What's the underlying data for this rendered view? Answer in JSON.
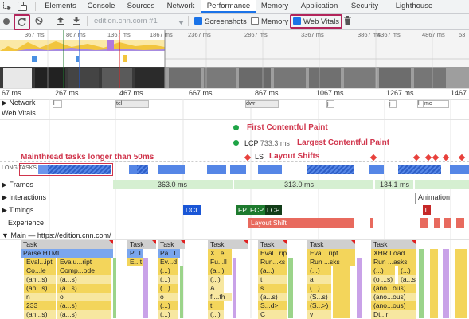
{
  "tabs": {
    "elements": "Elements",
    "console": "Console",
    "sources": "Sources",
    "network": "Network",
    "performance": "Performance",
    "memory": "Memory",
    "application": "Application",
    "security": "Security",
    "lighthouse": "Lighthouse"
  },
  "toolbar": {
    "profile_select": "edition.cnn.com #1",
    "screenshots_label": "Screenshots",
    "memory_label": "Memory",
    "web_vitals_label": "Web Vitals",
    "screenshots_checked": true,
    "memory_checked": false,
    "web_vitals_checked": true
  },
  "overview": {
    "ticks": [
      "367 ms",
      "867 ms",
      "1367 ms",
      "1867 ms",
      "2367 ms",
      "2867 ms",
      "3367 ms",
      "3867 ms",
      "4367 ms",
      "4867 ms",
      "53"
    ]
  },
  "ruler": {
    "ticks": [
      "67 ms",
      "267 ms",
      "467 ms",
      "667 ms",
      "867 ms",
      "1067 ms",
      "1267 ms",
      "1467"
    ]
  },
  "rows": {
    "network": "Network",
    "web_vitals": "Web Vitals",
    "frames": "Frames",
    "interactions": "Interactions",
    "timings": "Timings",
    "experience": "Experience",
    "main": "Main — https://edition.cnn.com/",
    "long_tasks": "LONG TASKS"
  },
  "network_items": [
    "l",
    "tel",
    "dwr",
    "j",
    "j",
    "l",
    "mc"
  ],
  "vitals": {
    "fcp_label": "First Contentful Paint",
    "lcp_short": "LCP",
    "lcp_value": "733.3 ms",
    "lcp_label": "Largest Contentful Paint",
    "ls_short": "LS",
    "ls_label": "Layout Shifts",
    "long_tasks_label": "Mainthread tasks longer than 50ms"
  },
  "frames": [
    "363.0 ms",
    "313.0 ms",
    "134.1 ms"
  ],
  "interactions": {
    "animation": "Animation"
  },
  "timings": {
    "dcl": "DCL",
    "fp": "FP",
    "fcp": "FCP",
    "lcp": "LCP",
    "l": "L"
  },
  "experience": {
    "layout_shift": "Layout Shift"
  },
  "flame": {
    "row1": [
      "Task",
      "Task",
      "Task",
      "Task",
      "Task",
      "Task",
      "Task"
    ],
    "row2": [
      "Parse HTML",
      "P...L",
      "Pa...L",
      "X...e",
      "Eval...ript",
      "Eval...ript",
      "XHR Load"
    ],
    "row3": [
      "Eval...ipt",
      "Evalu...ript",
      "E...t",
      "Ev...d",
      "Fu...ll",
      "Run...ks",
      "Run ...sks",
      "Run ...asks"
    ],
    "row4": [
      "Co...le",
      "Comp...ode",
      "(...)",
      "(a...)",
      "(a...)",
      "(...)",
      "(...)",
      "(...)"
    ],
    "row5": [
      "(an...s)",
      "(a...s)",
      "(...)",
      "(...)",
      "t",
      "a",
      "(o ...s)",
      "(a...s)"
    ],
    "row6": [
      "(an...s)",
      "(a...s)",
      "(...)",
      "A",
      "s",
      "(...)",
      "(ano...ous)"
    ],
    "row7": [
      "n",
      "o",
      "o",
      "fi...th",
      "(a...s)",
      "(S...s)",
      "(ano...ous)"
    ],
    "row8": [
      "233",
      "(a...s)",
      "(...)",
      "t",
      "S...d>",
      "(S...>)",
      "(ano...ous)"
    ],
    "row9": [
      "(an...s)",
      "(a...s)",
      "(...)",
      "(...)",
      "C",
      "v",
      "Dt...r"
    ]
  },
  "colors": {
    "accent": "#1a73e8",
    "highlight": "#b2245a",
    "vitals_red": "#d0344b",
    "fcp_green": "#1ea446",
    "frames_green": "#d5efd1",
    "task_grey": "#cfcfcf",
    "script_yellow": "#f3d55b"
  },
  "icons": [
    "inspect-icon",
    "device-toolbar-icon",
    "record-icon",
    "reload-record-icon",
    "clear-icon",
    "upload-icon",
    "download-icon",
    "garbage-collect-icon"
  ]
}
